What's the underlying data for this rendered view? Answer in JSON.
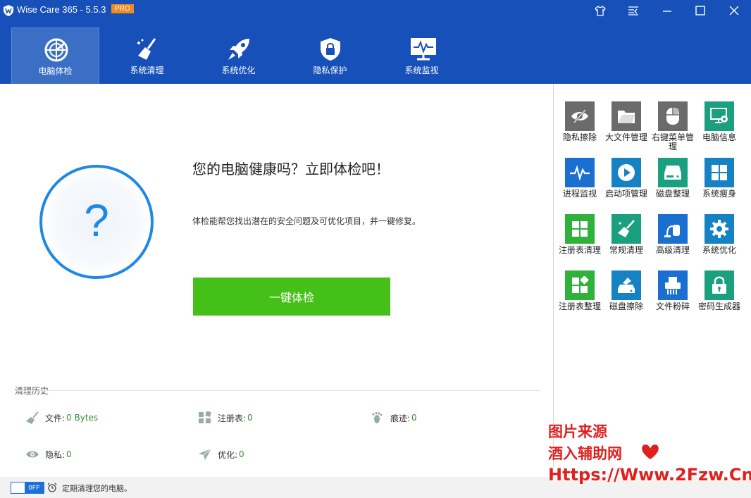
{
  "app": {
    "title": "Wise Care 365 - 5.5.3",
    "badge": "PRO"
  },
  "nav": {
    "tabs": [
      {
        "label": "电脑体检",
        "icon": "radar-icon",
        "active": true
      },
      {
        "label": "系统清理",
        "icon": "broom-icon"
      },
      {
        "label": "系统优化",
        "icon": "rocket-icon"
      },
      {
        "label": "隐私保护",
        "icon": "shield-lock-icon"
      },
      {
        "label": "系统监视",
        "icon": "monitor-pulse-icon"
      }
    ]
  },
  "main": {
    "headline": "您的电脑健康吗？立即体检吧！",
    "description": "体检能帮您找出潜在的安全问题及可优化项目，并一键修复。",
    "check_button": "一键体检",
    "question_mark": "?"
  },
  "history": {
    "title": "清理历史",
    "items": [
      {
        "label": "文件: ",
        "value": "0 Bytes",
        "icon": "broom-icon"
      },
      {
        "label": "注册表: ",
        "value": "0",
        "icon": "registry-icon"
      },
      {
        "label": "痕迹: ",
        "value": "0",
        "icon": "footprint-icon"
      },
      {
        "label": "隐私: ",
        "value": "0",
        "icon": "eye-icon"
      },
      {
        "label": "优化: ",
        "value": "0",
        "icon": "paper-plane-icon"
      }
    ]
  },
  "footer": {
    "toggle": "OFF",
    "text": "定期清理您的电脑。"
  },
  "tools": [
    {
      "label": "隐私擦除",
      "color": "#6b6b6b"
    },
    {
      "label": "大文件管理",
      "color": "#6b6b6b"
    },
    {
      "label": "右键菜单管理",
      "color": "#6b6b6b"
    },
    {
      "label": "电脑信息",
      "color": "#1a9f7f"
    },
    {
      "label": "进程监视",
      "color": "#1a6fd0"
    },
    {
      "label": "启动项管理",
      "color": "#1582c4"
    },
    {
      "label": "磁盘整理",
      "color": "#1a9f7f"
    },
    {
      "label": "系统瘦身",
      "color": "#1582c4"
    },
    {
      "label": "注册表清理",
      "color": "#2fb13a"
    },
    {
      "label": "常规清理",
      "color": "#1a9f7f"
    },
    {
      "label": "高级清理",
      "color": "#1a6fd0"
    },
    {
      "label": "系统优化",
      "color": "#1582c4"
    },
    {
      "label": "注册表整理",
      "color": "#2fb13a"
    },
    {
      "label": "磁盘擦除",
      "color": "#1582c4"
    },
    {
      "label": "文件粉碎",
      "color": "#1a6fd0"
    },
    {
      "label": "密码生成器",
      "color": "#1a9f7f"
    }
  ],
  "watermark": {
    "line1": "图片来源",
    "line2": "酒入辅助网",
    "line3": "Https://Www.2Fzw.Cn"
  }
}
